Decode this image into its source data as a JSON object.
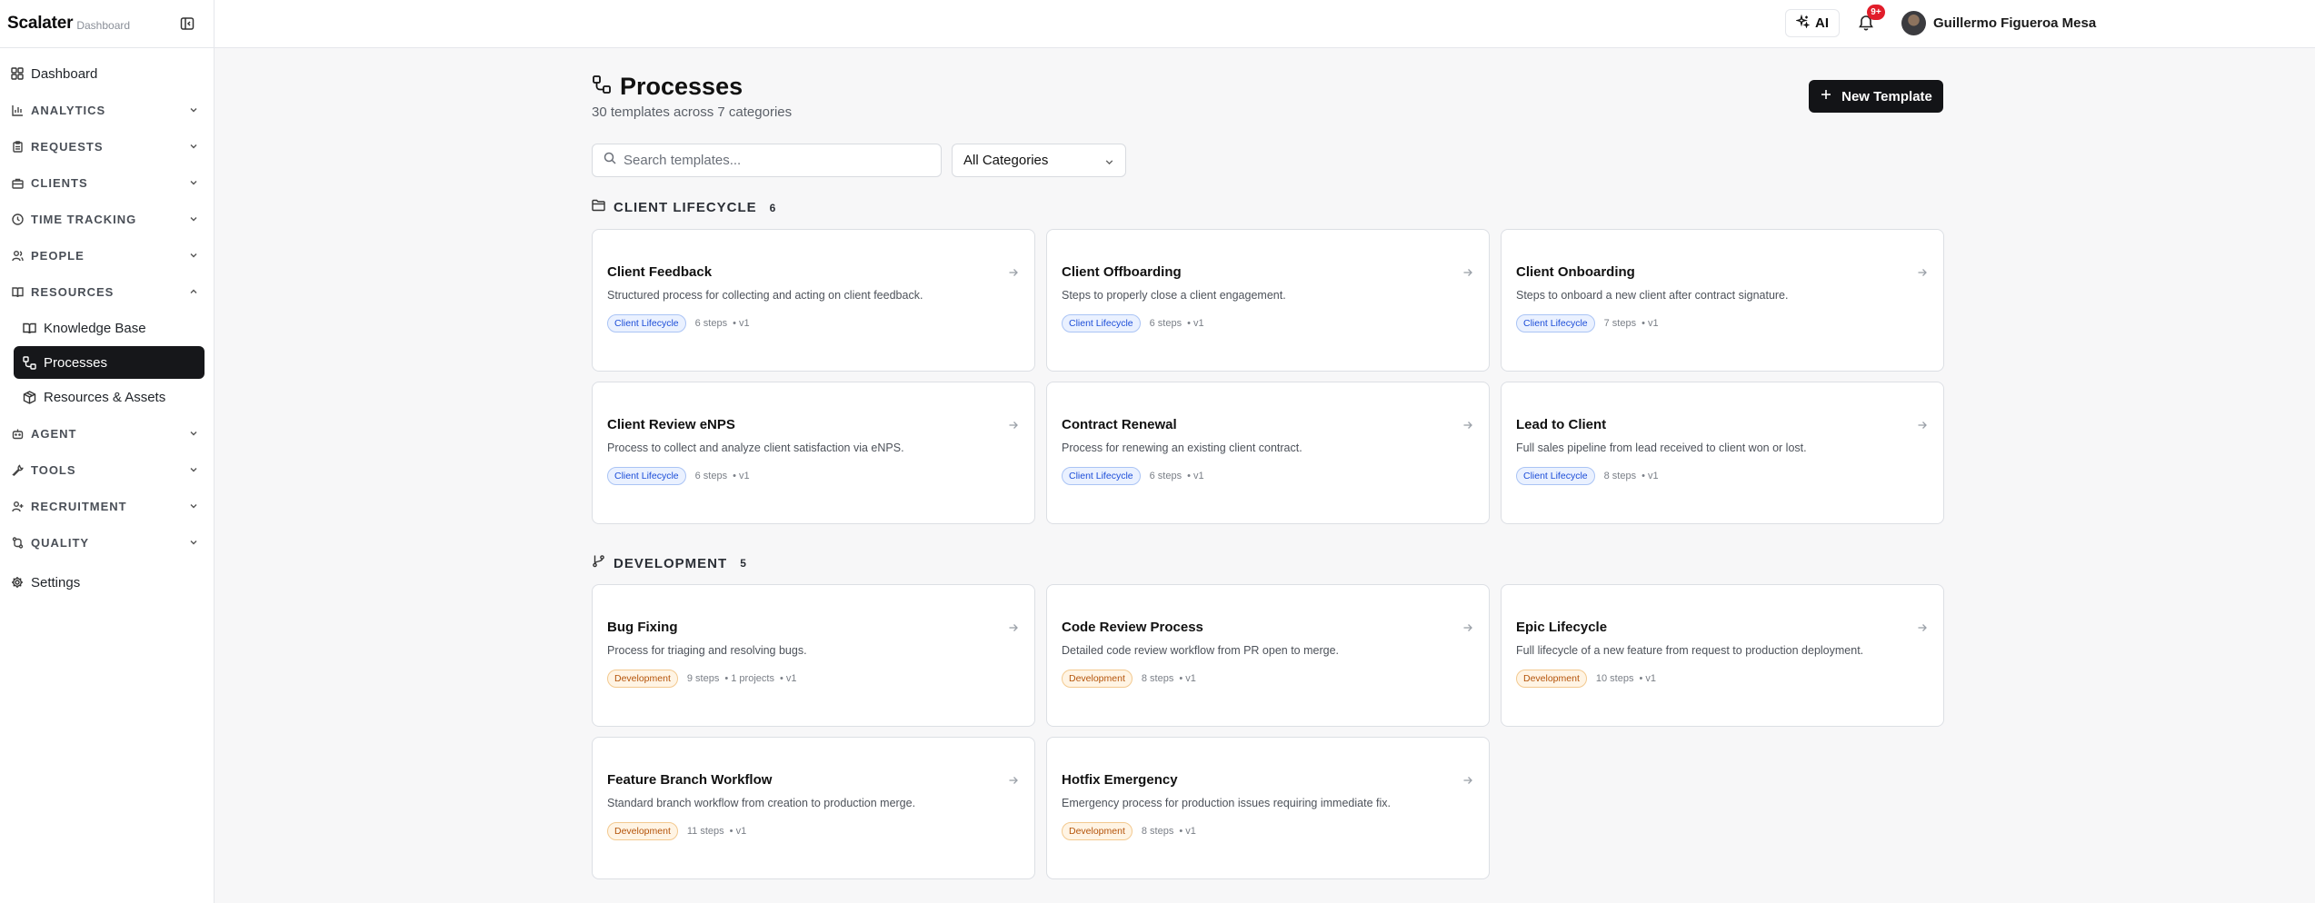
{
  "app": {
    "name": "Scalater",
    "subtitle": "Dashboard"
  },
  "sidebar": {
    "dashboard_label": "Dashboard",
    "sections": [
      {
        "label": "ANALYTICS",
        "icon": "bar-chart-icon"
      },
      {
        "label": "REQUESTS",
        "icon": "clipboard-icon"
      },
      {
        "label": "CLIENTS",
        "icon": "briefcase-icon"
      },
      {
        "label": "TIME TRACKING",
        "icon": "clock-icon"
      },
      {
        "label": "PEOPLE",
        "icon": "users-icon"
      },
      {
        "label": "RESOURCES",
        "icon": "book-icon",
        "expanded": true
      }
    ],
    "resources_items": [
      {
        "label": "Knowledge Base",
        "icon": "book-open-icon"
      },
      {
        "label": "Processes",
        "icon": "workflow-icon",
        "active": true
      },
      {
        "label": "Resources & Assets",
        "icon": "package-icon"
      }
    ],
    "lower_sections": [
      {
        "label": "AGENT",
        "icon": "bot-icon"
      },
      {
        "label": "TOOLS",
        "icon": "wrench-icon"
      },
      {
        "label": "RECRUITMENT",
        "icon": "user-plus-icon"
      },
      {
        "label": "QUALITY",
        "icon": "git-compare-icon"
      }
    ],
    "settings_label": "Settings"
  },
  "topbar": {
    "ai_label": "AI",
    "notifications_badge": "9+",
    "user_name": "Guillermo Figueroa Mesa"
  },
  "page": {
    "title": "Processes",
    "subtitle": "30 templates across 7 categories",
    "new_template_label": "New Template",
    "search_placeholder": "Search templates...",
    "category_filter": "All Categories"
  },
  "groups": [
    {
      "label": "CLIENT LIFECYCLE",
      "count": "6",
      "cards": [
        {
          "title": "Client Feedback",
          "desc": "Structured process for collecting and acting on client feedback.",
          "tag": "Client Lifecycle",
          "steps": "6 steps",
          "version": "• v1"
        },
        {
          "title": "Client Offboarding",
          "desc": "Steps to properly close a client engagement.",
          "tag": "Client Lifecycle",
          "steps": "6 steps",
          "version": "• v1"
        },
        {
          "title": "Client Onboarding",
          "desc": "Steps to onboard a new client after contract signature.",
          "tag": "Client Lifecycle",
          "steps": "7 steps",
          "version": "• v1"
        },
        {
          "title": "Client Review eNPS",
          "desc": "Process to collect and analyze client satisfaction via eNPS.",
          "tag": "Client Lifecycle",
          "steps": "6 steps",
          "version": "• v1"
        },
        {
          "title": "Contract Renewal",
          "desc": "Process for renewing an existing client contract.",
          "tag": "Client Lifecycle",
          "steps": "6 steps",
          "version": "• v1"
        },
        {
          "title": "Lead to Client",
          "desc": "Full sales pipeline from lead received to client won or lost.",
          "tag": "Client Lifecycle",
          "steps": "8 steps",
          "version": "• v1"
        }
      ]
    },
    {
      "label": "DEVELOPMENT",
      "count": "5",
      "cards": [
        {
          "title": "Bug Fixing",
          "desc": "Process for triaging and resolving bugs.",
          "tag": "Development",
          "steps": "9 steps",
          "projects": "• 1 projects",
          "version": "• v1"
        },
        {
          "title": "Code Review Process",
          "desc": "Detailed code review workflow from PR open to merge.",
          "tag": "Development",
          "steps": "8 steps",
          "version": "• v1"
        },
        {
          "title": "Epic Lifecycle",
          "desc": "Full lifecycle of a new feature from request to production deployment.",
          "tag": "Development",
          "steps": "10 steps",
          "version": "• v1"
        },
        {
          "title": "Feature Branch Workflow",
          "desc": "Standard branch workflow from creation to production merge.",
          "tag": "Development",
          "steps": "11 steps",
          "version": "• v1"
        },
        {
          "title": "Hotfix Emergency",
          "desc": "Emergency process for production issues requiring immediate fix.",
          "tag": "Development",
          "steps": "8 steps",
          "version": "• v1"
        }
      ]
    }
  ],
  "colors": {
    "accent_dark": "#131417",
    "tag_blue": "#1d4ed8",
    "tag_orange": "#b45309",
    "badge_red": "#e11d2a"
  }
}
